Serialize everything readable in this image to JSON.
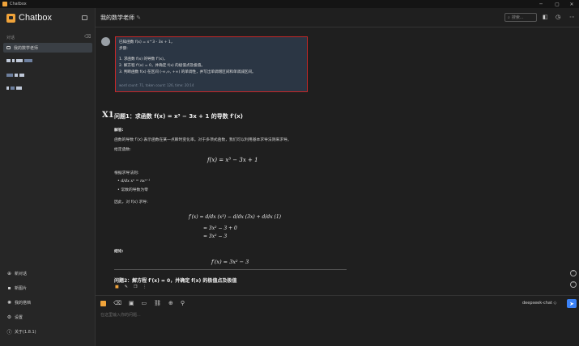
{
  "window": {
    "title": "Chatbox",
    "controls": [
      "─",
      "▢",
      "✕"
    ]
  },
  "sidebar": {
    "app_name": "Chatbox",
    "section_label": "对话",
    "clean_icon": "broom-icon",
    "active_chat": "我的数学老师",
    "bottom": [
      {
        "icon": "plus-circle-icon",
        "label": "新对话"
      },
      {
        "icon": "image-icon",
        "label": "新图片"
      },
      {
        "icon": "gear-circle-icon",
        "label": "我的搭档"
      },
      {
        "icon": "gear-icon",
        "label": "设置"
      },
      {
        "icon": "info-icon",
        "label": "关于(1.8.1)"
      }
    ]
  },
  "header": {
    "title": "我的数学老师",
    "search_placeholder": "搜索..."
  },
  "user_message": {
    "line1": "已知函数 f(x) = x^3 - 3x + 1，",
    "line2": "步骤:",
    "steps": [
      "1. 求函数 f(x) 的导数 f'(x)，",
      "2. 解方程 f'(x) = 0，并确定 f(x) 的极值点及极值。",
      "3. 判断函数 f(x) 在区间 (-∞,∞, +∞) 的单调性，并写出单调增区间和单调减区间。"
    ],
    "meta": "word count: 71, token count: 126, time: 20:14"
  },
  "ai_message": {
    "heading1": "问题1：求函数 f(x) = x³ − 3x + 1 的导数 f′(x)",
    "solution_label": "解答:",
    "para1": "函数的导数 f′(x) 表示函数在某一点瞬时变化率。对于多项式函数，我们可以利用基本求导法则来求导。",
    "given": "给定函数:",
    "eq1": "f(x) = x³ − 3x + 1",
    "rules_label": "根据求导法则:",
    "rule1": "d/dx xⁿ = nxⁿ⁻¹",
    "rule2": "常数的导数为零",
    "therefore": "因此，对 f(x) 求导:",
    "deriv_line1": "f′(x) = d/dx (x³) − d/dx (3x) + d/dx (1)",
    "deriv_line2": "= 3x² − 3 + 0",
    "deriv_line3": "= 3x² − 3",
    "conclusion_label": "结论:",
    "eq_result": "f′(x) = 3x² − 3",
    "heading2": "问题2：解方程 f′(x) = 0，并确定 f(x) 的极值点及极值"
  },
  "input": {
    "placeholder": "在这里输入你的问题...",
    "model": "deepseek-chat ◇"
  }
}
